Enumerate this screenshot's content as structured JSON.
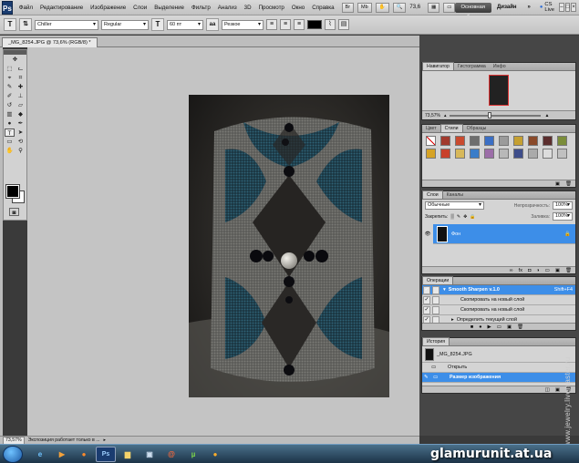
{
  "app": {
    "logo": "Ps",
    "menu": [
      "Файл",
      "Редактирование",
      "Изображение",
      "Слои",
      "Выделение",
      "Фильтр",
      "Анализ",
      "3D",
      "Просмотр",
      "Окно",
      "Справка"
    ],
    "zoom": "73,6",
    "workspace_button": "Основная рабочая среда",
    "design_label": "Дизайн",
    "more": "»",
    "cs_live": "CS Live"
  },
  "options": {
    "font_family": "Chiller",
    "font_style": "Regular",
    "font_size": "60 пт",
    "antialias": "Резкое",
    "text_color": "#000000"
  },
  "document": {
    "tab_title": "_MG_8254.JPG @ 73,6% (RGB/8) *"
  },
  "status": {
    "zoom": "73,57%",
    "message": "Экспозиция работает только в ..."
  },
  "navigator": {
    "tabs": [
      "Навигатор",
      "Гистограмма",
      "Инфо"
    ],
    "zoom": "73,57%"
  },
  "styles": {
    "tabs": [
      "Цвет",
      "Стили",
      "Образцы"
    ]
  },
  "layers": {
    "tabs": [
      "Слои",
      "Каналы"
    ],
    "blend_mode": "Обычные",
    "opacity_label": "Непрозрачность:",
    "opacity": "100%",
    "lock_label": "Закрепить:",
    "fill_label": "Заливка:",
    "fill": "100%",
    "layer_name": "Фон"
  },
  "actions": {
    "tab": "Операции",
    "items": [
      {
        "label": "Smooth Sharpen v.1.0",
        "shortcut": "Shift+F4"
      },
      {
        "label": "Скопировать на новый слой"
      },
      {
        "label": "Скопировать на новый слой"
      },
      {
        "label": "Определить текущий слой"
      }
    ]
  },
  "history": {
    "tab": "История",
    "snapshot": "_MG_8254.JPG",
    "items": [
      "Открыть",
      "Размер изображения"
    ]
  },
  "watermark": "glamurunit.at.ua",
  "side_watermark": "www.jewelry.livemaster.ru"
}
